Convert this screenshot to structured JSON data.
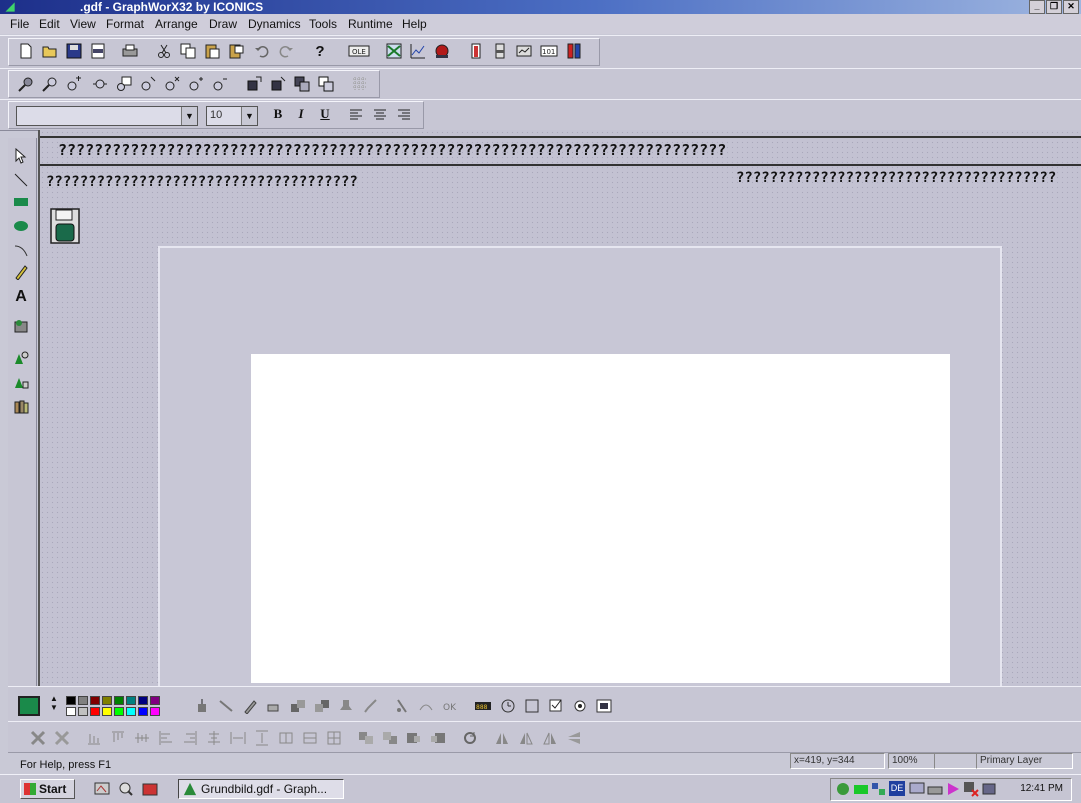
{
  "window": {
    "title": ".gdf - GraphWorX32 by ICONICS",
    "controls": [
      "minimize",
      "restore",
      "close"
    ]
  },
  "menu": [
    "File",
    "Edit",
    "View",
    "Format",
    "Arrange",
    "Draw",
    "Dynamics",
    "Tools",
    "Runtime",
    "Help"
  ],
  "format_toolbar": {
    "font_name": "",
    "font_size": "10",
    "bold_label": "B",
    "italic_label": "I",
    "underline_label": "U"
  },
  "toolbar_icons": {
    "standard": [
      "new-icon",
      "open-icon",
      "save-icon",
      "save-html-icon",
      "print-icon",
      "cut-icon",
      "copy-icon",
      "paste-icon",
      "paste-special-icon",
      "undo-icon",
      "redo-icon",
      "help-icon",
      "ole-icon",
      "chart-icon",
      "trend-icon",
      "alarm-icon",
      "gauge-icon",
      "slider-icon",
      "panel-icon",
      "numeric-101-icon",
      "thermometer-icon"
    ],
    "zoom": [
      "zoom-1-icon",
      "zoom-2-icon",
      "zoom-in-icon",
      "zoom-out-icon",
      "zoom-window-icon",
      "zoom-selection-icon",
      "zoom-fit-icon",
      "zoom-plus-icon",
      "zoom-minus-icon",
      "bring-front-icon",
      "send-back-icon",
      "group-icon",
      "ungroup-icon",
      "grid-icon"
    ]
  },
  "canvas": {
    "header_line": "??????????????????????????????????????????????????????????????????????????",
    "subtitle_left": "?????????????????????????????????????",
    "subtitle_right": "??????????????????????????????????????"
  },
  "palette_colors": [
    "#000000",
    "#808080",
    "#800000",
    "#808000",
    "#008000",
    "#008080",
    "#000080",
    "#800080",
    "#ffffff",
    "#c0c0c0",
    "#ff0000",
    "#ffff00",
    "#00ff00",
    "#00ffff",
    "#0000ff",
    "#ff00ff"
  ],
  "current_color": "#1a8a4a",
  "status": {
    "help_text": "For Help, press F1",
    "coords": "x=419, y=344",
    "zoom": "100%",
    "extra": "",
    "layer": "Primary Layer"
  },
  "taskbar": {
    "start_label": "Start",
    "task_label": "Grundbild.gdf - Graph...",
    "clock": "12:41 PM",
    "tray_label": "DE"
  }
}
